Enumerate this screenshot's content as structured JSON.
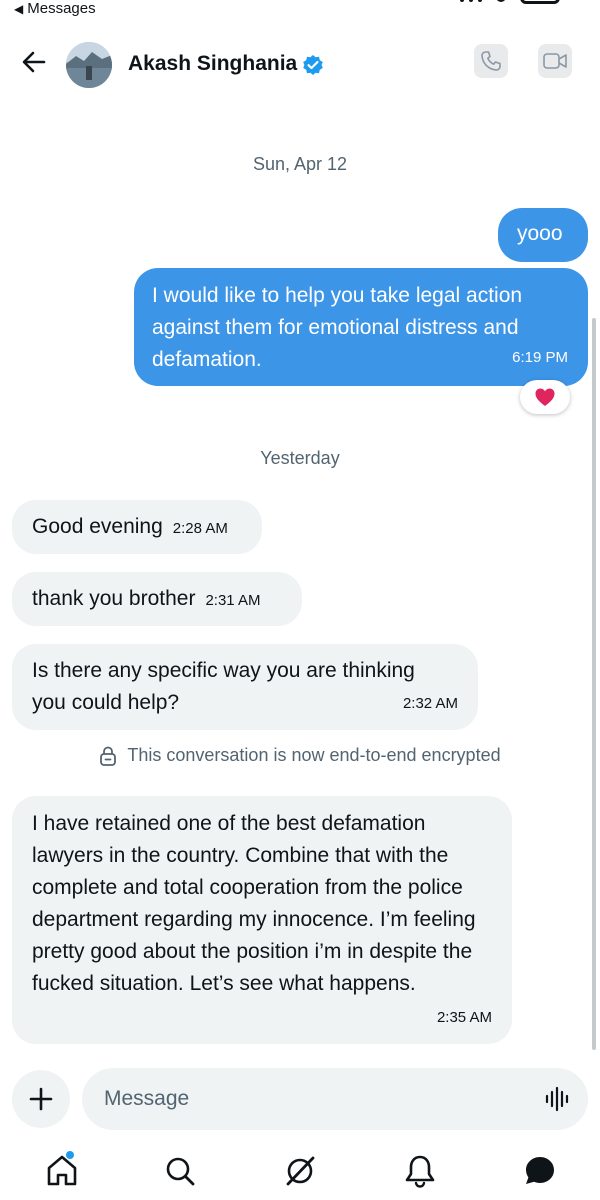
{
  "status_bar": {
    "back_label": "Messages"
  },
  "header": {
    "contact_name": "Akash Singhania"
  },
  "conversation": {
    "date_separator_1": "Sun, Apr 12",
    "date_separator_2": "Yesterday",
    "encryption_notice": "This conversation is now end-to-end encrypted",
    "messages": [
      {
        "direction": "out",
        "text": "yooo",
        "time": ""
      },
      {
        "direction": "out",
        "text": "I would like to help you take legal action against them for emotional distress and defamation.",
        "time": "6:19 PM",
        "reaction": "❤️"
      },
      {
        "direction": "in",
        "text": "Good evening",
        "time": "2:28 AM"
      },
      {
        "direction": "in",
        "text": "thank you brother",
        "time": "2:31 AM"
      },
      {
        "direction": "in",
        "text": "Is there any specific way you are thinking you could help?",
        "time": "2:32 AM"
      },
      {
        "direction": "in",
        "text": "I have retained one of the best defamation lawyers in the country. Combine that with the complete and total cooperation from the police department regarding my innocence. I’m feeling pretty good about the position i’m in despite the fucked situation. Let’s see what happens.",
        "time": "2:35 AM"
      }
    ]
  },
  "composer": {
    "placeholder": "Message"
  },
  "tabbar": {
    "active": "messages"
  },
  "colors": {
    "outgoing_bubble": "#3d95e8",
    "incoming_bubble": "#eff3f4",
    "accent": "#1d9bf0",
    "verified": "#1d9bf0"
  }
}
